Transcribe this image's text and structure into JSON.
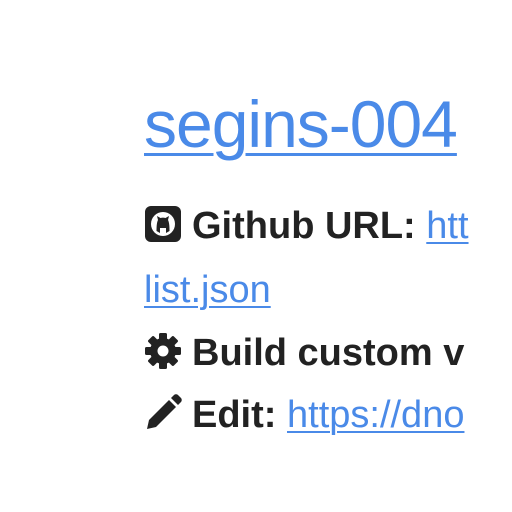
{
  "page": {
    "title": "segins-004"
  },
  "info": {
    "github": {
      "icon": "github-icon",
      "label": "Github URL:",
      "url_visible": "htt",
      "url_continued": "list.json"
    },
    "build": {
      "icon": "gear-icon",
      "label": "Build custom v"
    },
    "edit": {
      "icon": "pencil-icon",
      "label": "Edit:",
      "url_visible": "https://dno"
    }
  },
  "colors": {
    "link": "#4a8ae8",
    "text": "#222222",
    "background": "#ffffff"
  }
}
